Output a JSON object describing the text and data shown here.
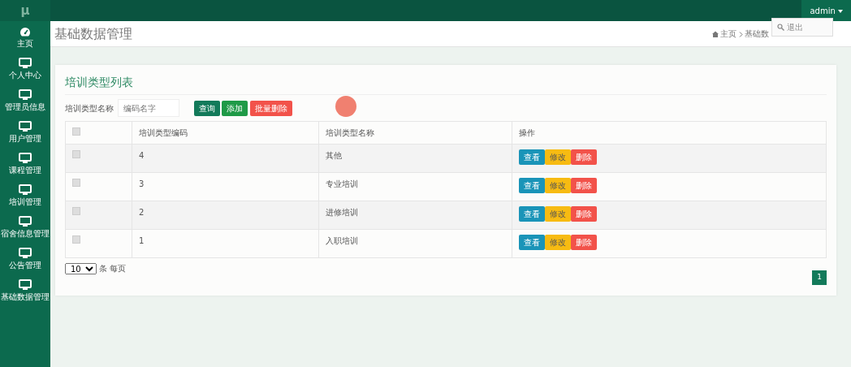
{
  "logo": "μ",
  "user_menu": {
    "label": "admin",
    "expanded": true,
    "items": [
      "退出"
    ]
  },
  "sidebar": {
    "items": [
      {
        "label": "主页",
        "kind": "gauge"
      },
      {
        "label": "个人中心",
        "kind": "monitor"
      },
      {
        "label": "管理员信息",
        "kind": "monitor"
      },
      {
        "label": "用户管理",
        "kind": "monitor"
      },
      {
        "label": "课程管理",
        "kind": "monitor"
      },
      {
        "label": "培训管理",
        "kind": "monitor"
      },
      {
        "label": "宿舍信息管理",
        "kind": "monitor"
      },
      {
        "label": "公告管理",
        "kind": "monitor"
      },
      {
        "label": "基础数据管理",
        "kind": "monitor"
      }
    ]
  },
  "page_title": "基础数据管理",
  "breadcrumb": [
    "主页",
    "基础数"
  ],
  "card": {
    "title": "培训类型列表",
    "search": {
      "label": "培训类型名称",
      "placeholder": "编码名字"
    },
    "buttons": [
      {
        "label": "查询",
        "kind": "query"
      },
      {
        "label": "添加",
        "kind": "add"
      },
      {
        "label": "批量删除",
        "kind": "delete"
      }
    ],
    "table": {
      "select_all": {
        "checked": false
      },
      "columns": [
        "培训类型编码",
        "培训类型名称",
        "操作"
      ],
      "rows": [
        {
          "checked": false,
          "code": "4",
          "name": "其他",
          "actions": [
            "查看",
            "修改",
            "删除"
          ]
        },
        {
          "checked": false,
          "code": "3",
          "name": "专业培训",
          "actions": [
            "查看",
            "修改",
            "删除"
          ]
        },
        {
          "checked": false,
          "code": "2",
          "name": "进修培训",
          "actions": [
            "查看",
            "修改",
            "删除"
          ]
        },
        {
          "checked": false,
          "code": "1",
          "name": "入职培训",
          "actions": [
            "查看",
            "修改",
            "删除"
          ]
        }
      ]
    },
    "page_size": {
      "value": "10",
      "label": "条 每页"
    },
    "pages": [
      {
        "label": "1",
        "selected": true
      }
    ]
  }
}
